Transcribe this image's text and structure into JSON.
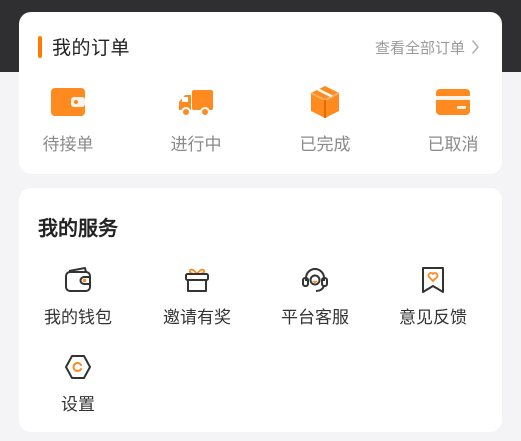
{
  "colors": {
    "accent": "#ff7a00",
    "icon_orange": "#ff8a1f",
    "background": "#f4f4f6",
    "header_band": "#2f2f31"
  },
  "orders": {
    "title": "我的订单",
    "view_all": "查看全部订单",
    "items": [
      {
        "label": "待接单",
        "icon": "wallet-box-icon"
      },
      {
        "label": "进行中",
        "icon": "delivery-truck-icon"
      },
      {
        "label": "已完成",
        "icon": "package-box-icon"
      },
      {
        "label": "已取消",
        "icon": "card-icon"
      }
    ]
  },
  "services": {
    "title": "我的服务",
    "items": [
      {
        "label": "我的钱包",
        "icon": "wallet-icon"
      },
      {
        "label": "邀请有奖",
        "icon": "gift-icon"
      },
      {
        "label": "平台客服",
        "icon": "headset-icon"
      },
      {
        "label": "意见反馈",
        "icon": "feedback-heart-icon"
      },
      {
        "label": "设置",
        "icon": "settings-icon"
      }
    ]
  }
}
